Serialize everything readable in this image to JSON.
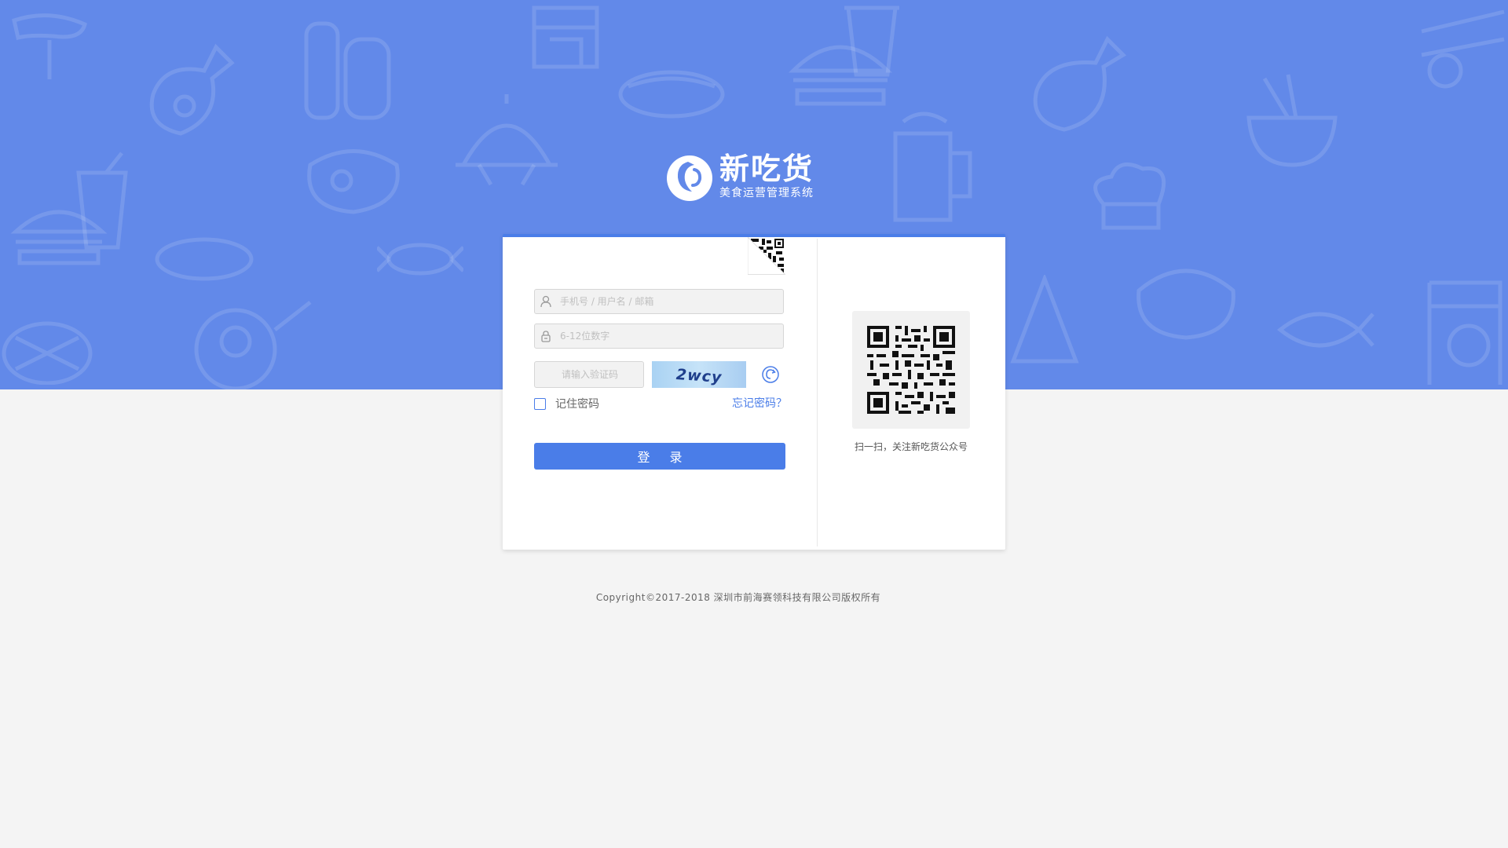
{
  "brand": {
    "name": "新吃货",
    "subtitle": "美食运营管理系统"
  },
  "login": {
    "account_placeholder": "手机号 / 用户名 / 邮箱",
    "password_placeholder": "6-12位数字",
    "captcha_placeholder": "请输入验证码",
    "captcha_text": "2wcy",
    "remember_label": "记住密码",
    "forgot_label": "忘记密码？",
    "submit_label": "登 录"
  },
  "qr_panel": {
    "caption": "扫一扫，关注新吃货公众号"
  },
  "footer": {
    "copyright": "Copyright©2017-2018 深圳市前海赛领科技有限公司版权所有"
  },
  "colors": {
    "primary": "#4a7de8",
    "banner": "#6289e9",
    "background": "#f4f4f4"
  }
}
